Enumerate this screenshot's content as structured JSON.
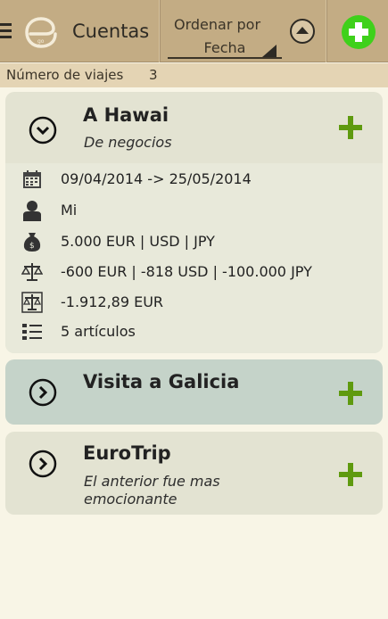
{
  "actionbar": {
    "title": "Cuentas",
    "sort_label": "Ordenar por",
    "sort_value": "Fecha"
  },
  "subheader": {
    "label": "Número de viajes",
    "count": "3"
  },
  "trips": [
    {
      "title": "A Hawai",
      "subtitle": "De negocios",
      "expanded": true,
      "details": {
        "dates": "09/04/2014 -> 25/05/2014",
        "person": "Mi",
        "budget": "5.000 EUR | USD | JPY",
        "balance": "-600 EUR | -818 USD | -100.000 JPY",
        "total": "-1.912,89 EUR",
        "items": "5 artículos"
      }
    },
    {
      "title": "Visita a Galicia",
      "subtitle": "",
      "expanded": false
    },
    {
      "title": "EuroTrip",
      "subtitle": "El anterior fue mas emocionante",
      "expanded": false
    }
  ],
  "colors": {
    "actionbar": "#c3ac84",
    "subheader": "#e4d4b4",
    "card": "#e3e3d2",
    "card_selected": "#c5d3c9",
    "accent_green": "#5f9a0f",
    "add_button": "#3fd11b"
  },
  "icons": {
    "menu": "hamburger-icon",
    "logo": "app-logo",
    "sort_direction": "sort-up-circle-icon",
    "add": "add-circle-icon",
    "expand": "chevron-down-circle-icon",
    "collapse": "chevron-right-circle-icon",
    "plus": "plus-icon",
    "calendar": "calendar-icon",
    "person": "person-icon",
    "money": "money-bag-icon",
    "balance": "scale-icon",
    "total": "scale-total-icon",
    "list": "list-icon"
  }
}
